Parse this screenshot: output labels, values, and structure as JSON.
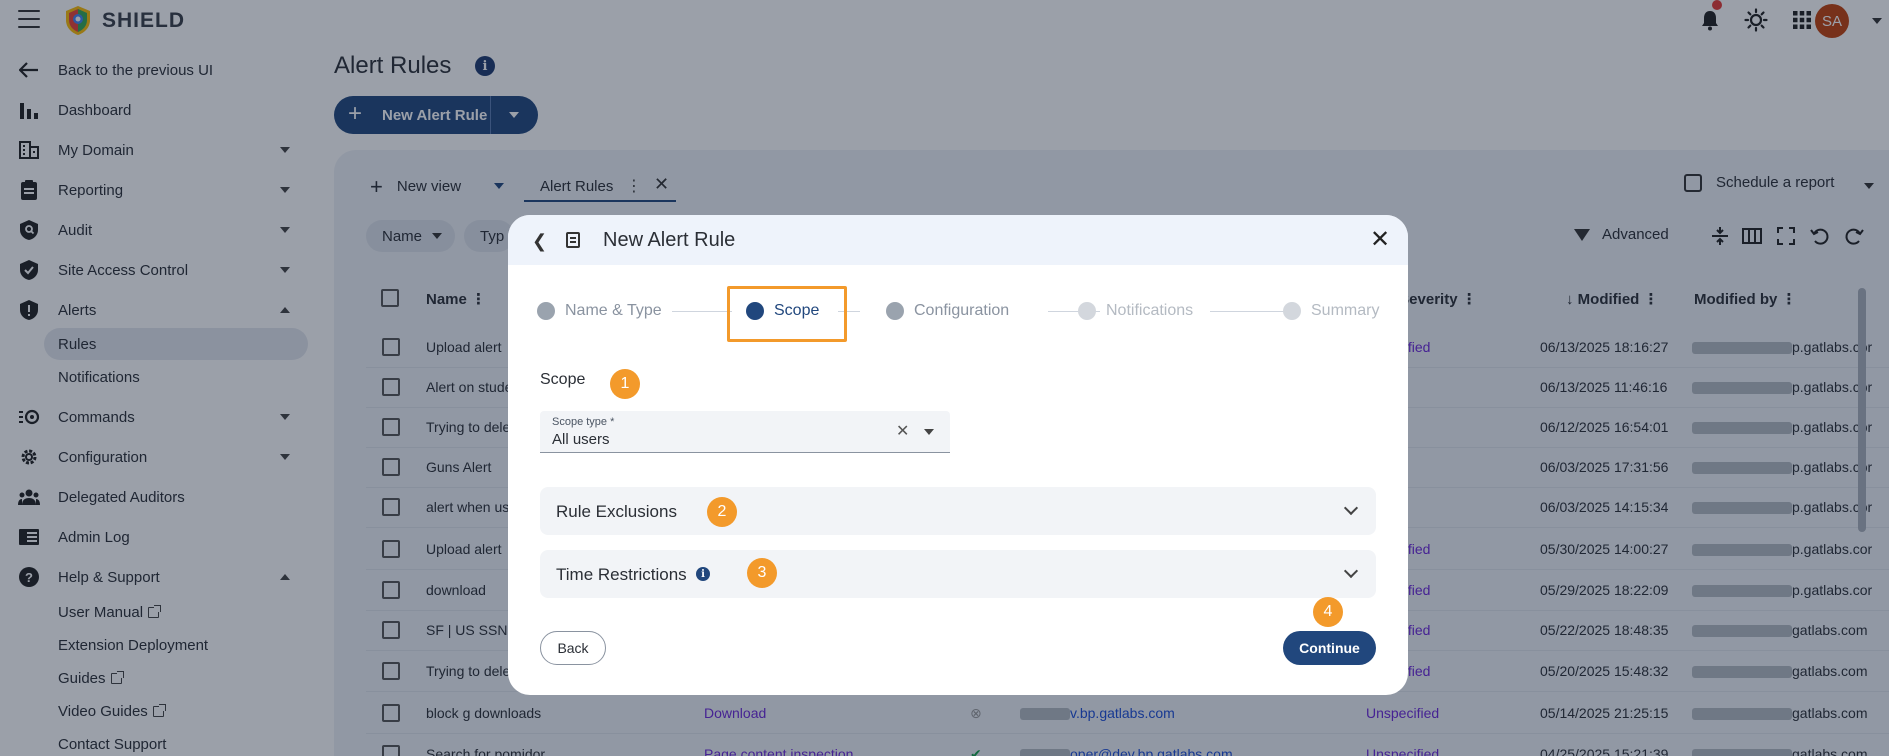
{
  "app": {
    "brand": "SHIELD",
    "avatar_initials": "SA"
  },
  "sidebar": {
    "back": "Back to the previous UI",
    "items": [
      {
        "label": "Dashboard",
        "icon": "bar-chart-icon"
      },
      {
        "label": "My Domain",
        "icon": "building-icon"
      },
      {
        "label": "Reporting",
        "icon": "clipboard-icon"
      },
      {
        "label": "Audit",
        "icon": "shield-search-icon"
      },
      {
        "label": "Site Access Control",
        "icon": "shield-check-icon"
      },
      {
        "label": "Alerts",
        "icon": "alert-shield-icon"
      },
      {
        "label": "Commands",
        "icon": "commands-icon"
      },
      {
        "label": "Configuration",
        "icon": "gear-icon"
      },
      {
        "label": "Delegated Auditors",
        "icon": "people-icon"
      },
      {
        "label": "Admin Log",
        "icon": "book-icon"
      },
      {
        "label": "Help & Support",
        "icon": "help-icon"
      }
    ],
    "alerts_sub": [
      "Rules",
      "Notifications"
    ],
    "help_sub": [
      "User Manual",
      "Extension Deployment",
      "Guides",
      "Video Guides",
      "Contact Support"
    ]
  },
  "main": {
    "title": "Alert Rules",
    "new_button": "New Alert Rule",
    "tabs": {
      "new_view": "New view",
      "alert_rules": "Alert Rules"
    },
    "schedule": "Schedule a report",
    "filters": {
      "name": "Name",
      "type": "Typ"
    },
    "advanced": "Advanced",
    "columns": {
      "name": "Name",
      "severity": "t Severity",
      "modified": "Modified",
      "modified_by": "Modified by"
    },
    "rows": [
      {
        "name": "Upload alert",
        "severity": "ecified",
        "modified": "06/13/2025 18:16:27",
        "by": "p.gatlabs.cor"
      },
      {
        "name": "Alert on stude",
        "severity": "",
        "modified": "06/13/2025 11:46:16",
        "by": "p.gatlabs.cor"
      },
      {
        "name": "Trying to dele",
        "severity": "",
        "modified": "06/12/2025 16:54:01",
        "by": "p.gatlabs.cor"
      },
      {
        "name": "Guns Alert",
        "severity": "",
        "modified": "06/03/2025 17:31:56",
        "by": "p.gatlabs.cor"
      },
      {
        "name": "alert when us",
        "severity": "",
        "modified": "06/03/2025 14:15:34",
        "by": "p.gatlabs.cor"
      },
      {
        "name": "Upload alert",
        "severity": "ecified",
        "modified": "05/30/2025 14:00:27",
        "by": "p.gatlabs.cor"
      },
      {
        "name": "download",
        "severity": "ecified",
        "modified": "05/29/2025 18:22:09",
        "by": "p.gatlabs.cor"
      },
      {
        "name": "SF | US SSN E",
        "severity": "ecified",
        "modified": "05/22/2025 18:48:35",
        "by": "gatlabs.com"
      },
      {
        "name": "Trying to dele",
        "severity": "ecified",
        "modified": "05/20/2025 15:48:32",
        "by": "gatlabs.com"
      },
      {
        "name": "block g downloads",
        "type": "Download",
        "scope": "v.bp.gatlabs.com",
        "severity": "Unspecified",
        "modified": "05/14/2025 21:25:15",
        "by": "gatlabs.com"
      },
      {
        "name": "Search for pomidor",
        "type": "Page content inspection",
        "scope": "oper@dev.bp.gatlabs.com",
        "severity": "Unspecified",
        "modified": "04/25/2025 15:21:39",
        "by": "gatlabs.com"
      }
    ]
  },
  "modal": {
    "title": "New Alert Rule",
    "steps": [
      "Name & Type",
      "Scope",
      "Configuration",
      "Notifications",
      "Summary"
    ],
    "scope_title": "Scope",
    "scope_type_label": "Scope type *",
    "scope_type_value": "All users",
    "rule_exclusions": "Rule Exclusions",
    "time_restrictions": "Time Restrictions",
    "back": "Back",
    "continue": "Continue",
    "badges": [
      "1",
      "2",
      "3",
      "4"
    ]
  }
}
